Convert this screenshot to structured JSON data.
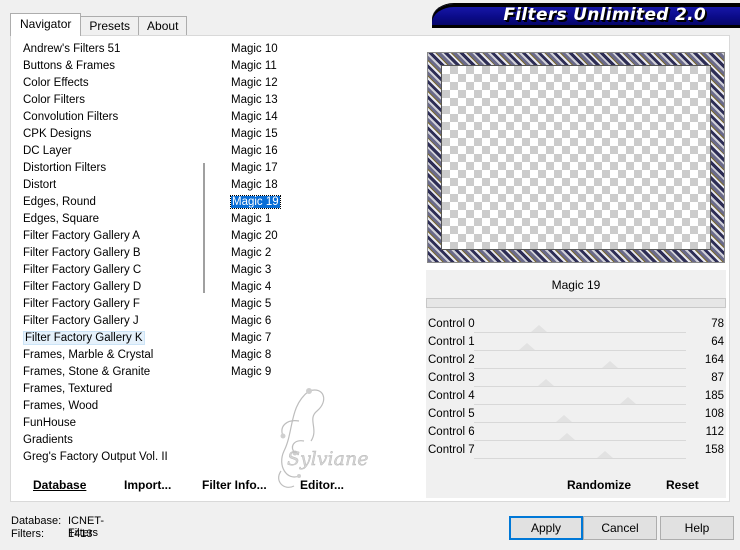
{
  "tabs": [
    {
      "label": "Navigator",
      "active": true
    },
    {
      "label": "Presets",
      "active": false
    },
    {
      "label": "About",
      "active": false
    }
  ],
  "app_title": "Filters Unlimited 2.0",
  "categories": [
    "Andrew's Filters 51",
    "Buttons & Frames",
    "Color Effects",
    "Color Filters",
    "Convolution Filters",
    "CPK Designs",
    "DC Layer",
    "Distortion Filters",
    "Distort",
    "Edges, Round",
    "Edges, Square",
    "Filter Factory Gallery A",
    "Filter Factory Gallery B",
    "Filter Factory Gallery C",
    "Filter Factory Gallery D",
    "Filter Factory Gallery F",
    "Filter Factory Gallery J",
    "Filter Factory Gallery K",
    "Frames, Marble & Crystal",
    "Frames, Stone & Granite",
    "Frames, Textured",
    "Frames, Wood",
    "FunHouse",
    "Gradients",
    "Greg's Factory Output Vol. II"
  ],
  "hovered_category": "Filter Factory Gallery K",
  "filters": [
    "Magic 10",
    "Magic 11",
    "Magic 12",
    "Magic 13",
    "Magic 14",
    "Magic 15",
    "Magic 16",
    "Magic 17",
    "Magic 18",
    "Magic 19",
    "Magic 1",
    "Magic 20",
    "Magic 2",
    "Magic 3",
    "Magic 4",
    "Magic 5",
    "Magic 6",
    "Magic 7",
    "Magic 8",
    "Magic 9"
  ],
  "selected_filter": "Magic 19",
  "preview_label": "Magic 19",
  "controls": [
    {
      "label": "Control 0",
      "value": 78
    },
    {
      "label": "Control 1",
      "value": 64
    },
    {
      "label": "Control 2",
      "value": 164
    },
    {
      "label": "Control 3",
      "value": 87
    },
    {
      "label": "Control 4",
      "value": 185
    },
    {
      "label": "Control 5",
      "value": 108
    },
    {
      "label": "Control 6",
      "value": 112
    },
    {
      "label": "Control 7",
      "value": 158
    }
  ],
  "control_max": 255,
  "toolbar": {
    "database_label": "Database",
    "import_label": "Import...",
    "filter_info_label": "Filter Info...",
    "editor_label": "Editor...",
    "randomize_label": "Randomize",
    "reset_label": "Reset"
  },
  "status": {
    "database_label": "Database:",
    "database_value": "ICNET-Filters",
    "filters_label": "Filters:",
    "filters_value": "1413"
  },
  "buttons": {
    "apply": "Apply",
    "cancel": "Cancel",
    "help": "Help"
  },
  "watermark_text": "Sylviane",
  "colors": {
    "selection": "#0a6ed6",
    "banner": "#0b0b8a",
    "default_button_border": "#0078d7"
  }
}
